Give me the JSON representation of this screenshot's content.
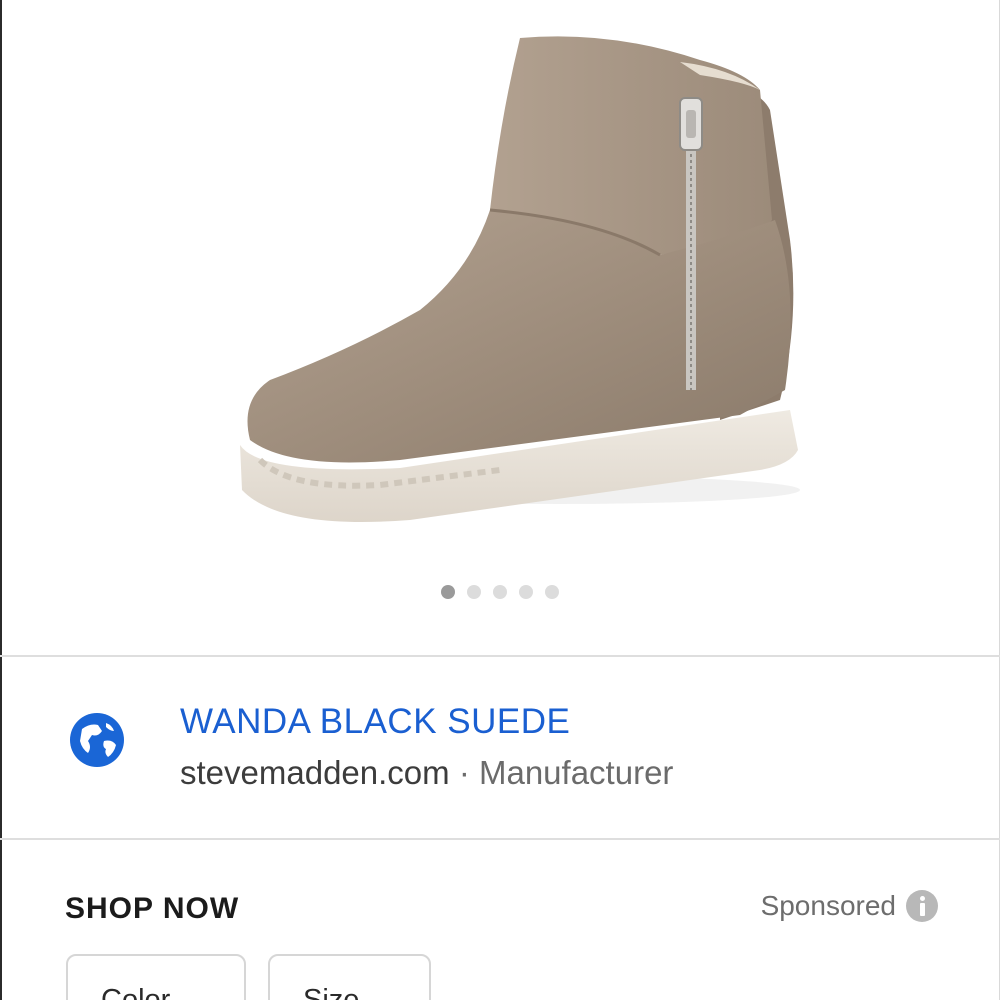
{
  "carousel": {
    "slide_count": 5,
    "active_index": 0
  },
  "result": {
    "title": "WANDA BLACK SUEDE",
    "domain": "stevemadden.com",
    "separator": "·",
    "source_type": "Manufacturer",
    "icon": "globe-icon"
  },
  "shopping": {
    "heading": "SHOP NOW",
    "sponsored_label": "Sponsored",
    "info_icon": "info-icon"
  },
  "filters": [
    {
      "label": "Color",
      "icon": "chevron-down-icon"
    },
    {
      "label": "Size",
      "icon": "chevron-down-icon"
    }
  ],
  "colors": {
    "link_blue": "#1a5fd1",
    "icon_blue": "#1a66d6",
    "boot_suede": "#a08f7e",
    "sole": "#e9e3da"
  }
}
